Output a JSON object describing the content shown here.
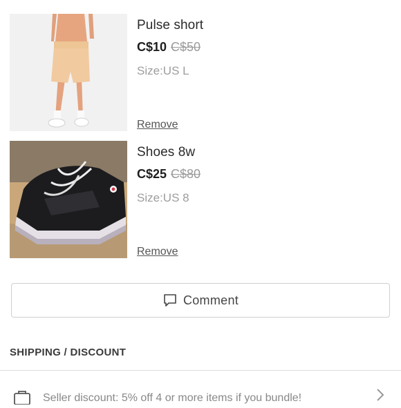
{
  "cart": {
    "items": [
      {
        "title": "Pulse short",
        "price_now": "C$10",
        "price_was": "C$50",
        "size": "Size:US L",
        "remove_label": "Remove",
        "image": "photo-person-in-peach-shorts-and-white-sneakers"
      },
      {
        "title": "Shoes 8w",
        "price_now": "C$25",
        "price_was": "C$80",
        "size": "Size:US 8",
        "remove_label": "Remove",
        "image": "photo-black-athletic-sneakers"
      }
    ]
  },
  "comment": {
    "label": "Comment",
    "icon": "speech-bubble-icon"
  },
  "shipping": {
    "heading": "SHIPPING / DISCOUNT",
    "discount_text": "Seller discount: 5% off 4 or more items if you bundle!",
    "icon": "shopping-bag-icon"
  },
  "colors": {
    "background": "#ffffff",
    "text": "#222222",
    "muted": "#9a9a9a",
    "border": "#cfcfcf"
  }
}
